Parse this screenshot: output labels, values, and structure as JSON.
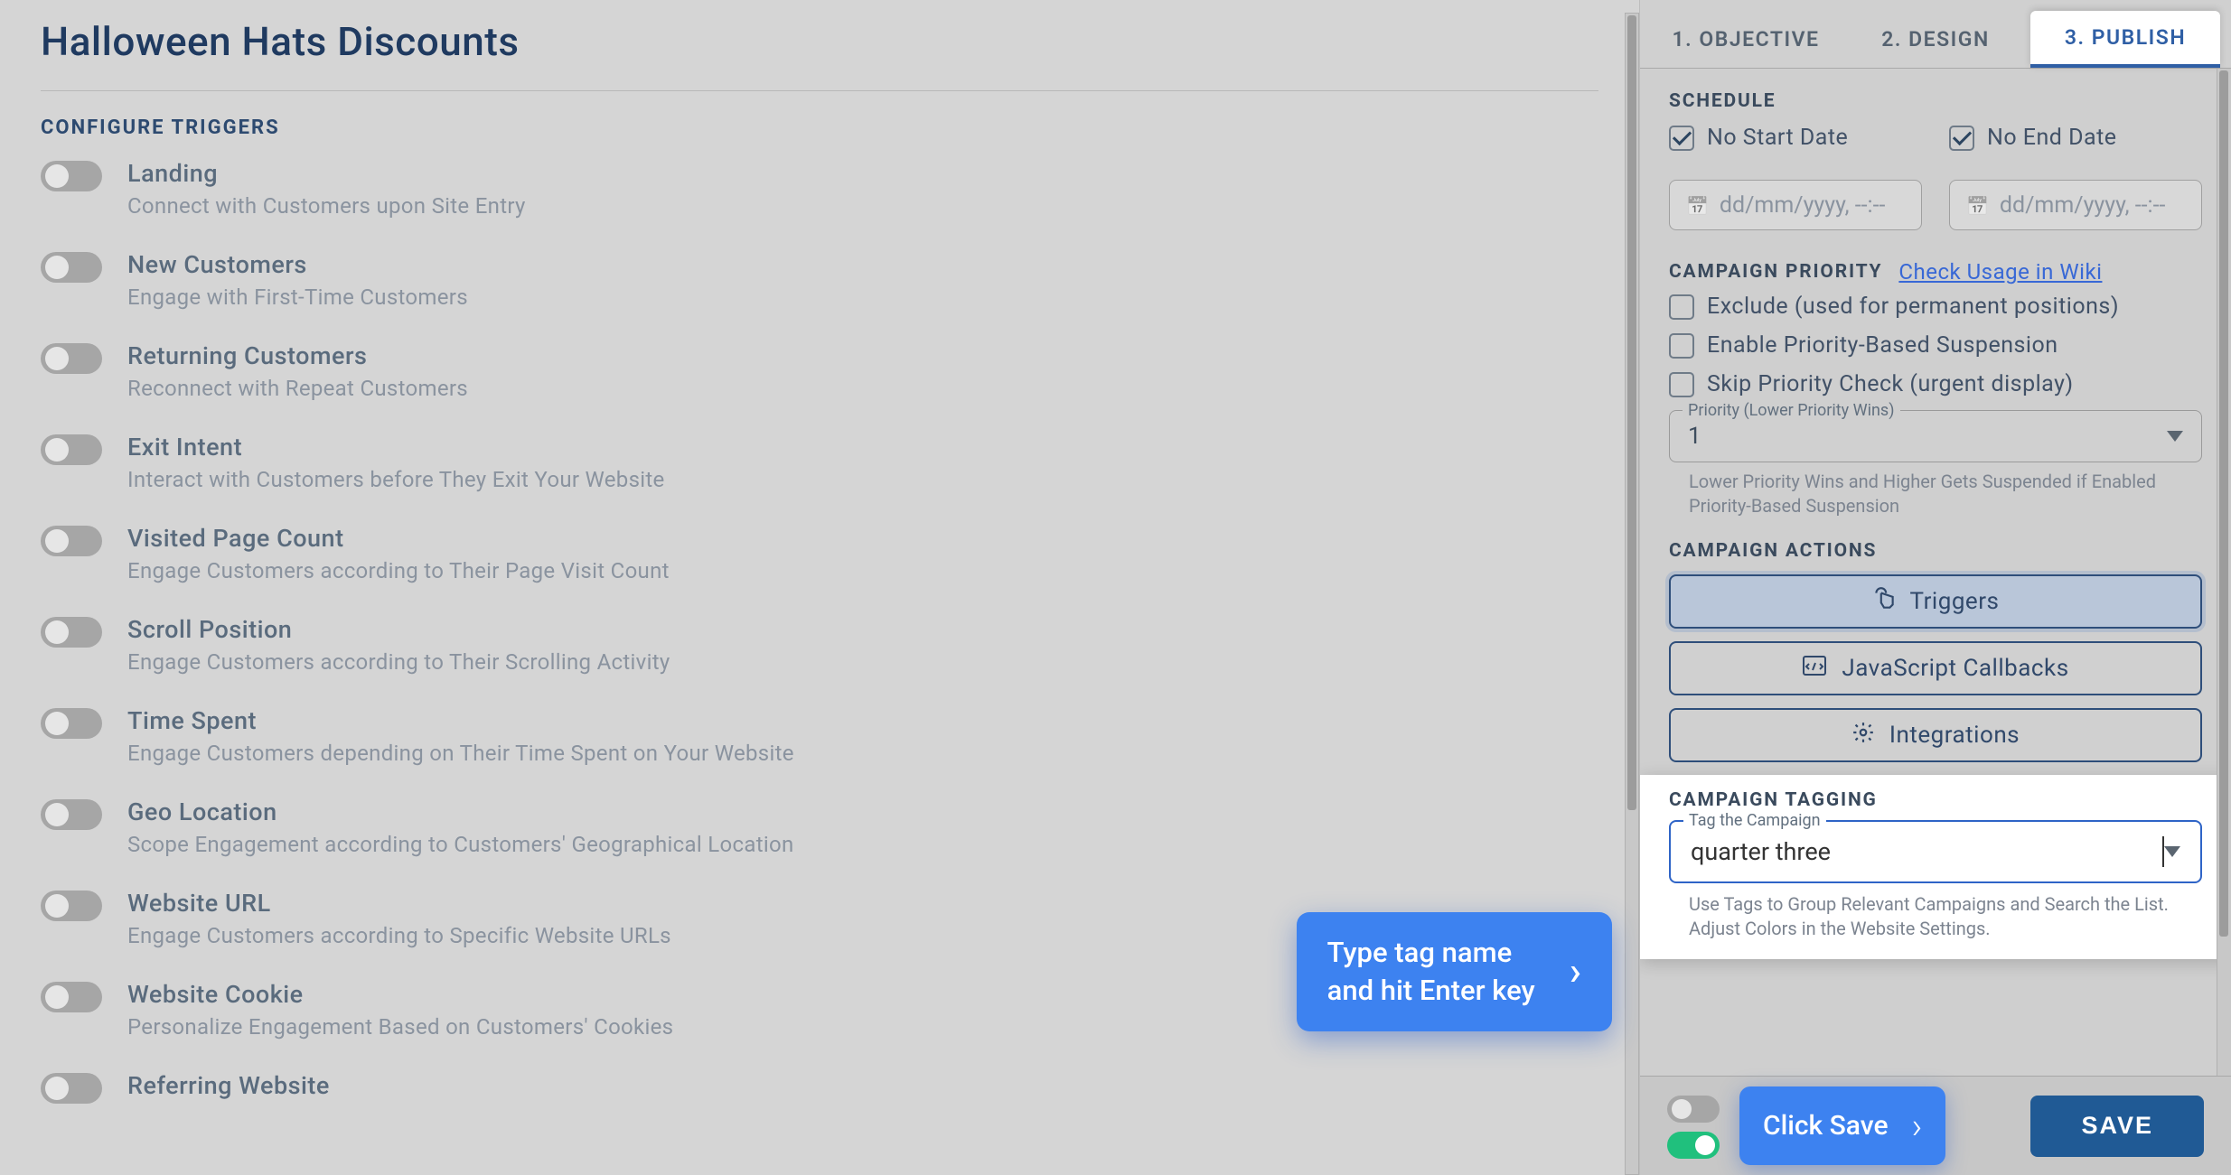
{
  "page_title": "Halloween Hats Discounts",
  "section_triggers": "CONFIGURE TRIGGERS",
  "triggers": [
    {
      "title": "Landing",
      "desc": "Connect with Customers upon Site Entry"
    },
    {
      "title": "New Customers",
      "desc": "Engage with First-Time Customers"
    },
    {
      "title": "Returning Customers",
      "desc": "Reconnect with Repeat Customers"
    },
    {
      "title": "Exit Intent",
      "desc": "Interact with Customers before They Exit Your Website"
    },
    {
      "title": "Visited Page Count",
      "desc": "Engage Customers according to Their Page Visit Count"
    },
    {
      "title": "Scroll Position",
      "desc": "Engage Customers according to Their Scrolling Activity"
    },
    {
      "title": "Time Spent",
      "desc": "Engage Customers depending on Their Time Spent on Your Website"
    },
    {
      "title": "Geo Location",
      "desc": "Scope Engagement according to Customers' Geographical Location"
    },
    {
      "title": "Website URL",
      "desc": "Engage Customers according to Specific Website URLs"
    },
    {
      "title": "Website Cookie",
      "desc": "Personalize Engagement Based on Customers' Cookies"
    },
    {
      "title": "Referring Website",
      "desc": ""
    }
  ],
  "tabs": {
    "objective": "1. OBJECTIVE",
    "design": "2. DESIGN",
    "publish": "3. PUBLISH"
  },
  "schedule": {
    "label": "SCHEDULE",
    "no_start": "No Start Date",
    "no_end": "No End Date",
    "placeholder": "dd/mm/yyyy, --:--"
  },
  "priority": {
    "label": "CAMPAIGN PRIORITY",
    "link": "Check Usage in Wiki",
    "exclude": "Exclude (used for permanent positions)",
    "enable": "Enable Priority-Based Suspension",
    "skip": "Skip Priority Check (urgent display)",
    "field_legend": "Priority (Lower Priority Wins)",
    "value": "1",
    "help": "Lower Priority Wins and Higher Gets Suspended if Enabled Priority-Based Suspension"
  },
  "actions": {
    "label": "CAMPAIGN ACTIONS",
    "triggers": "Triggers",
    "js": "JavaScript Callbacks",
    "integrations": "Integrations"
  },
  "tagging": {
    "label": "CAMPAIGN TAGGING",
    "legend": "Tag the Campaign",
    "value": "quarter three",
    "help": "Use Tags to Group Relevant Campaigns and Search the List. Adjust Colors in the Website Settings."
  },
  "tooltips": {
    "type_tag": "Type tag name\nand hit Enter key",
    "click_save": "Click Save"
  },
  "save": "SAVE"
}
